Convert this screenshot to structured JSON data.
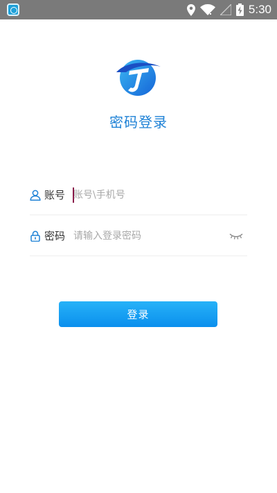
{
  "status_bar": {
    "time": "5:30",
    "icons": [
      "app-notification-icon",
      "location-icon",
      "wifi-icon",
      "signal-icon",
      "battery-charging-icon"
    ]
  },
  "header": {
    "logo": "app-logo",
    "title": "密码登录"
  },
  "form": {
    "account": {
      "icon": "user-icon",
      "label": "账号",
      "placeholder": "账号\\手机号",
      "value": ""
    },
    "password": {
      "icon": "lock-icon",
      "label": "密码",
      "placeholder": "请输入登录密码",
      "value": "",
      "toggle_icon": "eye-closed-icon"
    }
  },
  "login_button": {
    "label": "登录"
  },
  "colors": {
    "accent": "#1f82d6",
    "button_gradient_top": "#27b2f8",
    "button_gradient_bottom": "#0a8fed",
    "status_bar": "#7a7a7a"
  }
}
